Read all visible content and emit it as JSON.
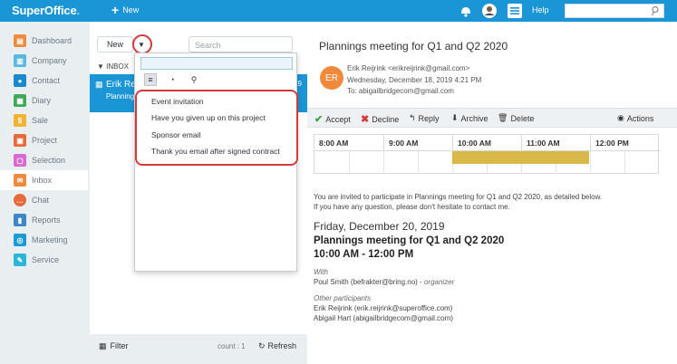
{
  "topbar": {
    "logo": "SuperOffice",
    "logo_suffix": ".",
    "new_label": "New",
    "help_label": "Help"
  },
  "sidebar": {
    "items": [
      {
        "label": "Dashboard",
        "icon": "dashboard-icon",
        "color": "#f08a3c"
      },
      {
        "label": "Company",
        "icon": "company-icon",
        "color": "#5ab7e0"
      },
      {
        "label": "Contact",
        "icon": "contact-icon",
        "color": "#1a8ad0"
      },
      {
        "label": "Diary",
        "icon": "diary-icon",
        "color": "#3fa957"
      },
      {
        "label": "Sale",
        "icon": "sale-icon",
        "color": "#f2b234"
      },
      {
        "label": "Project",
        "icon": "project-icon",
        "color": "#e86a3b"
      },
      {
        "label": "Selection",
        "icon": "selection-icon",
        "color": "#d86ad0"
      },
      {
        "label": "Inbox",
        "icon": "inbox-icon",
        "color": "#f08a3c"
      },
      {
        "label": "Chat",
        "icon": "chat-icon",
        "color": "#e86a3b"
      },
      {
        "label": "Reports",
        "icon": "reports-icon",
        "color": "#3f86c7"
      },
      {
        "label": "Marketing",
        "icon": "marketing-icon",
        "color": "#1a9ad6"
      },
      {
        "label": "Service",
        "icon": "service-icon",
        "color": "#2bb5d9"
      }
    ]
  },
  "list": {
    "new_label": "New",
    "search_placeholder": "Search",
    "inbox_header": "▼ INBOX",
    "message": {
      "from": "Erik Reijrink",
      "subject": "Plannings meeting for Q1 and Q2 2020",
      "date": "12/19"
    },
    "filter_label": "Filter",
    "count_label": "count : 1",
    "refresh_label": "Refresh"
  },
  "popup": {
    "items": [
      "Event invitation",
      "Have you given up on this project",
      "Sponsor email",
      "Thank you email after signed contract"
    ]
  },
  "detail": {
    "title": "Plannings meeting for Q1 and Q2 2020",
    "avatar_initials": "ER",
    "sender_line": "Erik Reijrink <erikreijrink@gmail.com>",
    "date_line": "Wednesday, December 18, 2019 4:21 PM",
    "to_line": "To: abigailbridgecom@gmail.com",
    "actions": {
      "accept": "Accept",
      "decline": "Decline",
      "reply": "Reply",
      "archive": "Archive",
      "delete": "Delete",
      "more": "Actions"
    },
    "calendar_hours": [
      "8:00 AM",
      "9:00 AM",
      "10:00 AM",
      "11:00 AM",
      "12:00 PM"
    ],
    "invite_line1": "You are invited to participate in Plannings meeting for Q1 and Q2 2020, as detailed below.",
    "invite_line2": "If you have any question, please don't hesitate to contact me.",
    "event_date": "Friday, December 20, 2019",
    "event_title": "Plannings meeting for Q1 and Q2 2020",
    "event_time": "10:00 AM - 12:00 PM",
    "with_label": "With",
    "with_person": "Poul Smith (befrakter@bring.no) - ",
    "with_role": "organizer",
    "others_label": "Other participants",
    "other1": "Erik Reijrink (erik.reijrink@superoffice.com)",
    "other2": "Abigail Hart (abigailbridgecom@gmail.com)"
  }
}
